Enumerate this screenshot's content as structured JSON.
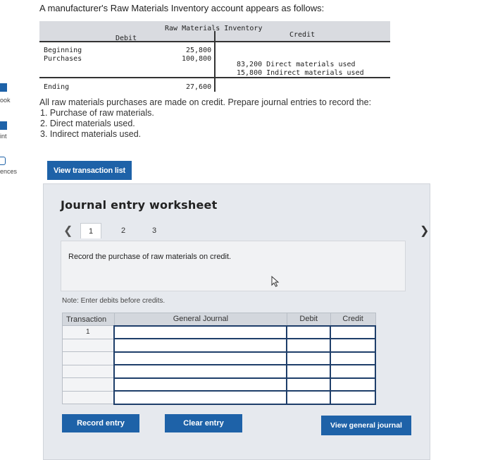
{
  "left_rail": {
    "items": [
      "ook",
      "int",
      "ences"
    ]
  },
  "question": {
    "title": "A manufacturer's Raw Materials Inventory account appears as follows:"
  },
  "t_account": {
    "title": "Raw Materials Inventory",
    "debit_header": "Debit",
    "credit_header": "Credit",
    "rows": {
      "beginning_label": "Beginning",
      "beginning_value": "25,800",
      "purchases_label": "Purchases",
      "purchases_value": "100,800",
      "credit_1": "83,200 Direct materials used",
      "credit_2": "15,800 Indirect materials used",
      "ending_label": "Ending",
      "ending_value": "27,600"
    }
  },
  "instructions": {
    "intro": "All raw materials purchases are made on credit. Prepare journal entries to record the:",
    "items": [
      "1. Purchase of raw materials.",
      "2. Direct materials used.",
      "3. Indirect materials used."
    ]
  },
  "buttons": {
    "view_transaction_list": "View transaction list",
    "record_entry": "Record entry",
    "clear_entry": "Clear entry",
    "view_general_journal": "View general journal"
  },
  "worksheet": {
    "title": "Journal entry worksheet",
    "pages": [
      "1",
      "2",
      "3"
    ],
    "active_page": "1",
    "prompt": "Record the purchase of raw materials on credit.",
    "note": "Note: Enter debits before credits.",
    "table": {
      "headers": [
        "Transaction",
        "General Journal",
        "Debit",
        "Credit"
      ],
      "first_transaction": "1"
    }
  },
  "colors": {
    "primary_button": "#1e62a8",
    "worksheet_bg": "#e6e9ee"
  }
}
